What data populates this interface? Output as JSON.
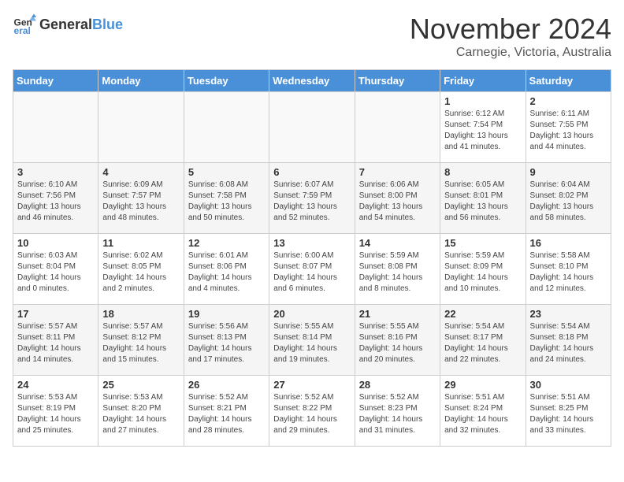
{
  "header": {
    "logo_general": "General",
    "logo_blue": "Blue",
    "month_title": "November 2024",
    "location": "Carnegie, Victoria, Australia"
  },
  "days_of_week": [
    "Sunday",
    "Monday",
    "Tuesday",
    "Wednesday",
    "Thursday",
    "Friday",
    "Saturday"
  ],
  "weeks": [
    [
      {
        "day": "",
        "info": ""
      },
      {
        "day": "",
        "info": ""
      },
      {
        "day": "",
        "info": ""
      },
      {
        "day": "",
        "info": ""
      },
      {
        "day": "",
        "info": ""
      },
      {
        "day": "1",
        "info": "Sunrise: 6:12 AM\nSunset: 7:54 PM\nDaylight: 13 hours\nand 41 minutes."
      },
      {
        "day": "2",
        "info": "Sunrise: 6:11 AM\nSunset: 7:55 PM\nDaylight: 13 hours\nand 44 minutes."
      }
    ],
    [
      {
        "day": "3",
        "info": "Sunrise: 6:10 AM\nSunset: 7:56 PM\nDaylight: 13 hours\nand 46 minutes."
      },
      {
        "day": "4",
        "info": "Sunrise: 6:09 AM\nSunset: 7:57 PM\nDaylight: 13 hours\nand 48 minutes."
      },
      {
        "day": "5",
        "info": "Sunrise: 6:08 AM\nSunset: 7:58 PM\nDaylight: 13 hours\nand 50 minutes."
      },
      {
        "day": "6",
        "info": "Sunrise: 6:07 AM\nSunset: 7:59 PM\nDaylight: 13 hours\nand 52 minutes."
      },
      {
        "day": "7",
        "info": "Sunrise: 6:06 AM\nSunset: 8:00 PM\nDaylight: 13 hours\nand 54 minutes."
      },
      {
        "day": "8",
        "info": "Sunrise: 6:05 AM\nSunset: 8:01 PM\nDaylight: 13 hours\nand 56 minutes."
      },
      {
        "day": "9",
        "info": "Sunrise: 6:04 AM\nSunset: 8:02 PM\nDaylight: 13 hours\nand 58 minutes."
      }
    ],
    [
      {
        "day": "10",
        "info": "Sunrise: 6:03 AM\nSunset: 8:04 PM\nDaylight: 14 hours\nand 0 minutes."
      },
      {
        "day": "11",
        "info": "Sunrise: 6:02 AM\nSunset: 8:05 PM\nDaylight: 14 hours\nand 2 minutes."
      },
      {
        "day": "12",
        "info": "Sunrise: 6:01 AM\nSunset: 8:06 PM\nDaylight: 14 hours\nand 4 minutes."
      },
      {
        "day": "13",
        "info": "Sunrise: 6:00 AM\nSunset: 8:07 PM\nDaylight: 14 hours\nand 6 minutes."
      },
      {
        "day": "14",
        "info": "Sunrise: 5:59 AM\nSunset: 8:08 PM\nDaylight: 14 hours\nand 8 minutes."
      },
      {
        "day": "15",
        "info": "Sunrise: 5:59 AM\nSunset: 8:09 PM\nDaylight: 14 hours\nand 10 minutes."
      },
      {
        "day": "16",
        "info": "Sunrise: 5:58 AM\nSunset: 8:10 PM\nDaylight: 14 hours\nand 12 minutes."
      }
    ],
    [
      {
        "day": "17",
        "info": "Sunrise: 5:57 AM\nSunset: 8:11 PM\nDaylight: 14 hours\nand 14 minutes."
      },
      {
        "day": "18",
        "info": "Sunrise: 5:57 AM\nSunset: 8:12 PM\nDaylight: 14 hours\nand 15 minutes."
      },
      {
        "day": "19",
        "info": "Sunrise: 5:56 AM\nSunset: 8:13 PM\nDaylight: 14 hours\nand 17 minutes."
      },
      {
        "day": "20",
        "info": "Sunrise: 5:55 AM\nSunset: 8:14 PM\nDaylight: 14 hours\nand 19 minutes."
      },
      {
        "day": "21",
        "info": "Sunrise: 5:55 AM\nSunset: 8:16 PM\nDaylight: 14 hours\nand 20 minutes."
      },
      {
        "day": "22",
        "info": "Sunrise: 5:54 AM\nSunset: 8:17 PM\nDaylight: 14 hours\nand 22 minutes."
      },
      {
        "day": "23",
        "info": "Sunrise: 5:54 AM\nSunset: 8:18 PM\nDaylight: 14 hours\nand 24 minutes."
      }
    ],
    [
      {
        "day": "24",
        "info": "Sunrise: 5:53 AM\nSunset: 8:19 PM\nDaylight: 14 hours\nand 25 minutes."
      },
      {
        "day": "25",
        "info": "Sunrise: 5:53 AM\nSunset: 8:20 PM\nDaylight: 14 hours\nand 27 minutes."
      },
      {
        "day": "26",
        "info": "Sunrise: 5:52 AM\nSunset: 8:21 PM\nDaylight: 14 hours\nand 28 minutes."
      },
      {
        "day": "27",
        "info": "Sunrise: 5:52 AM\nSunset: 8:22 PM\nDaylight: 14 hours\nand 29 minutes."
      },
      {
        "day": "28",
        "info": "Sunrise: 5:52 AM\nSunset: 8:23 PM\nDaylight: 14 hours\nand 31 minutes."
      },
      {
        "day": "29",
        "info": "Sunrise: 5:51 AM\nSunset: 8:24 PM\nDaylight: 14 hours\nand 32 minutes."
      },
      {
        "day": "30",
        "info": "Sunrise: 5:51 AM\nSunset: 8:25 PM\nDaylight: 14 hours\nand 33 minutes."
      }
    ]
  ]
}
